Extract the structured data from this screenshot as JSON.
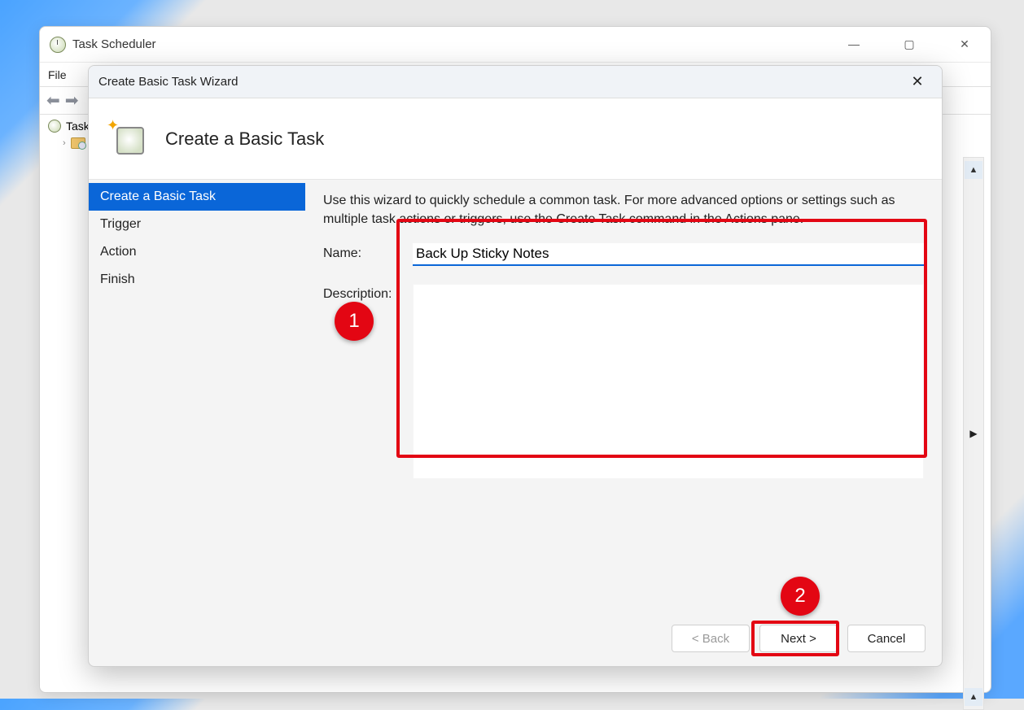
{
  "main_window": {
    "title": "Task Scheduler",
    "menu": {
      "file": "File"
    },
    "tree": {
      "root": "Task"
    }
  },
  "wizard": {
    "title": "Create Basic Task Wizard",
    "heading": "Create a Basic Task",
    "intro": "Use this wizard to quickly schedule a common task.  For more advanced options or settings such as multiple task actions or triggers, use the Create Task command in the Actions pane.",
    "steps": {
      "create": "Create a Basic Task",
      "trigger": "Trigger",
      "action": "Action",
      "finish": "Finish"
    },
    "labels": {
      "name": "Name:",
      "description": "Description:"
    },
    "values": {
      "name": "Back Up Sticky Notes",
      "description": ""
    },
    "buttons": {
      "back": "< Back",
      "next": "Next >",
      "cancel": "Cancel"
    }
  },
  "annotations": {
    "callout1": "1",
    "callout2": "2"
  }
}
